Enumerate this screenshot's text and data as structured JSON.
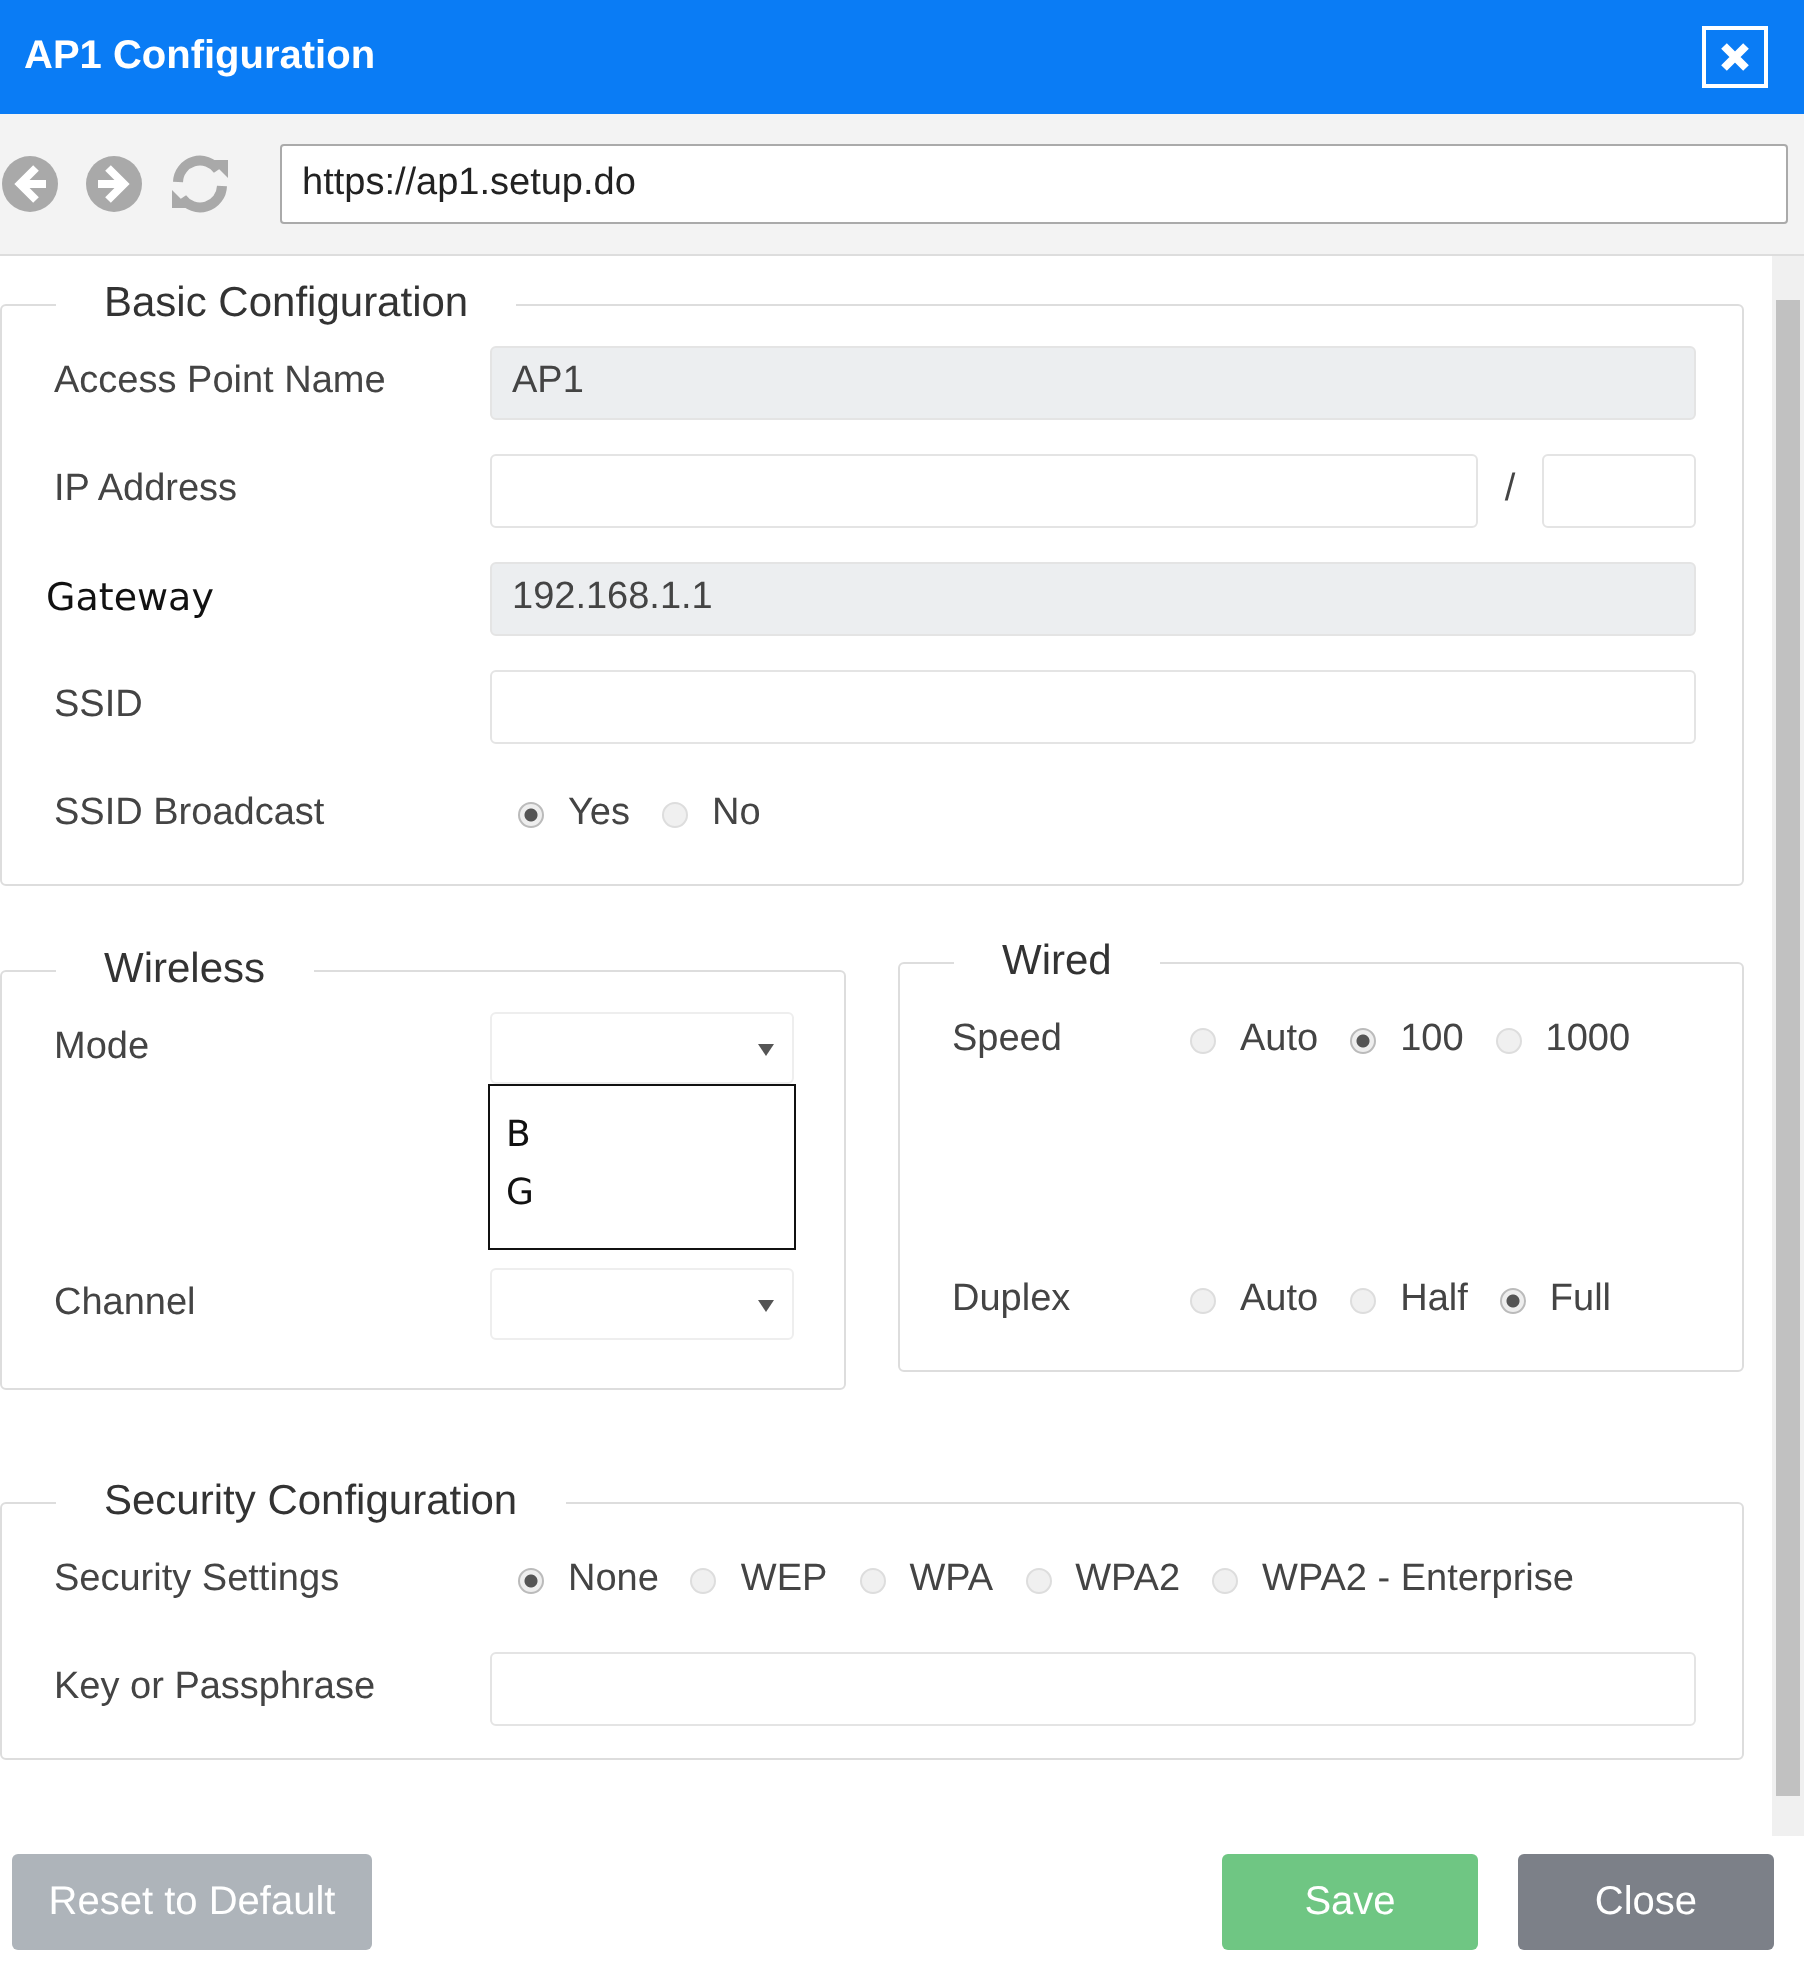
{
  "window": {
    "title": "AP1 Configuration"
  },
  "address_bar": {
    "value": "https://ap1.setup.do"
  },
  "basic": {
    "title": "Basic Configuration",
    "fields": [
      {
        "kind": "text",
        "label": "Access Point Name",
        "value": "AP1",
        "disabled": true
      },
      {
        "kind": "ip",
        "label": "IP Address",
        "separator": "/"
      },
      {
        "kind": "text",
        "label": "Gateway",
        "value": "192.168.1.1",
        "disabled": true
      },
      {
        "kind": "text",
        "label": "SSID",
        "disabled": false
      },
      {
        "kind": "radio",
        "label": "SSID Broadcast",
        "options": [
          {
            "label": "Yes",
            "selected": true
          },
          {
            "label": "No",
            "selected": false
          }
        ]
      }
    ]
  },
  "wireless": {
    "title": "Wireless",
    "mode": {
      "label": "Mode",
      "list_options": [
        "B",
        "G"
      ]
    },
    "channel": {
      "label": "Channel"
    }
  },
  "wired": {
    "title": "Wired",
    "fields": [
      {
        "label": "Speed",
        "options": [
          {
            "label": "Auto",
            "selected": false
          },
          {
            "label": "100",
            "selected": true
          },
          {
            "label": "1000",
            "selected": false
          }
        ]
      },
      {
        "label": "Duplex",
        "options": [
          {
            "label": "Auto",
            "selected": false
          },
          {
            "label": "Half",
            "selected": false
          },
          {
            "label": "Full",
            "selected": true
          }
        ]
      }
    ]
  },
  "security": {
    "title": "Security Configuration",
    "fields": [
      {
        "kind": "radio",
        "label": "Security Settings",
        "options": [
          {
            "label": "None",
            "selected": true
          },
          {
            "label": "WEP",
            "selected": false
          },
          {
            "label": "WPA",
            "selected": false
          },
          {
            "label": "WPA2",
            "selected": false
          },
          {
            "label": "WPA2 - Enterprise",
            "selected": false
          }
        ]
      },
      {
        "kind": "text",
        "label": "Key or Passphrase"
      }
    ]
  },
  "buttons": [
    {
      "label": "Reset to Default",
      "kind": "reset"
    },
    {
      "label": "Save",
      "kind": "save"
    },
    {
      "label": "Close",
      "kind": "close"
    }
  ]
}
